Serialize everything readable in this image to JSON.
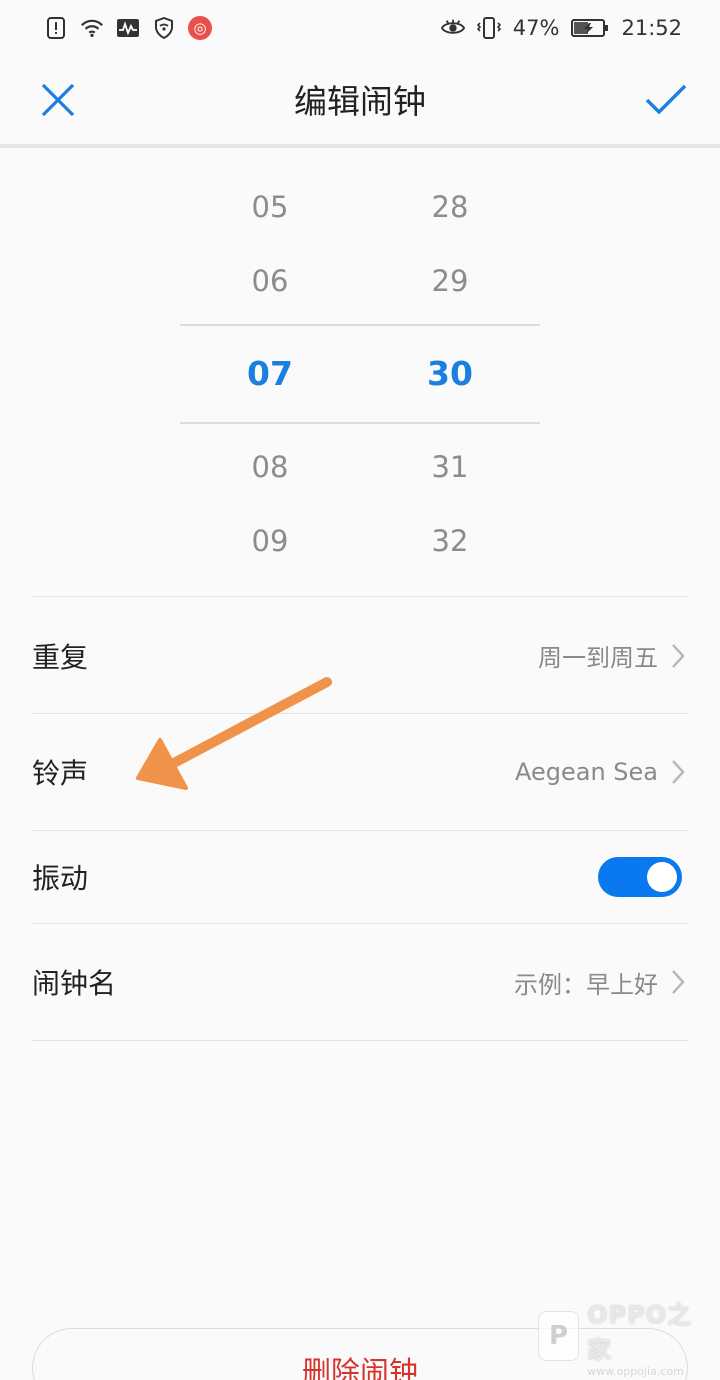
{
  "status_bar": {
    "battery_percent": "47%",
    "time": "21:52",
    "icons_left": [
      "alert-icon",
      "wifi-icon",
      "activity-icon",
      "shield-icon",
      "netease-music-icon"
    ],
    "icons_right": [
      "eye-icon",
      "vibrate-icon",
      "battery-icon"
    ],
    "netease_glyph": "◎"
  },
  "header": {
    "title": "编辑闹钟",
    "close_icon": "close-icon",
    "confirm_icon": "check-icon",
    "accent": "#1a7fe0"
  },
  "picker": {
    "hours": [
      "05",
      "06",
      "07",
      "08",
      "09"
    ],
    "minutes": [
      "28",
      "29",
      "30",
      "31",
      "32"
    ],
    "selected_hour": "07",
    "selected_minute": "30",
    "selected_color": "#1a7fe0"
  },
  "settings": {
    "repeat": {
      "label": "重复",
      "value": "周一到周五"
    },
    "ringtone": {
      "label": "铃声",
      "value": "Aegean Sea"
    },
    "vibrate": {
      "label": "振动",
      "enabled": true,
      "color": "#0a79f0"
    },
    "alarm_name": {
      "label": "闹钟名",
      "value": "示例：早上好"
    }
  },
  "delete_button": {
    "label": "删除闹钟",
    "color": "#d6332b"
  },
  "annotation": {
    "color": "#f0924a",
    "icon": "annotation-arrow"
  },
  "watermark": {
    "title": "OPPO之家",
    "sub": "www.oppojia.com",
    "logo": "P"
  }
}
